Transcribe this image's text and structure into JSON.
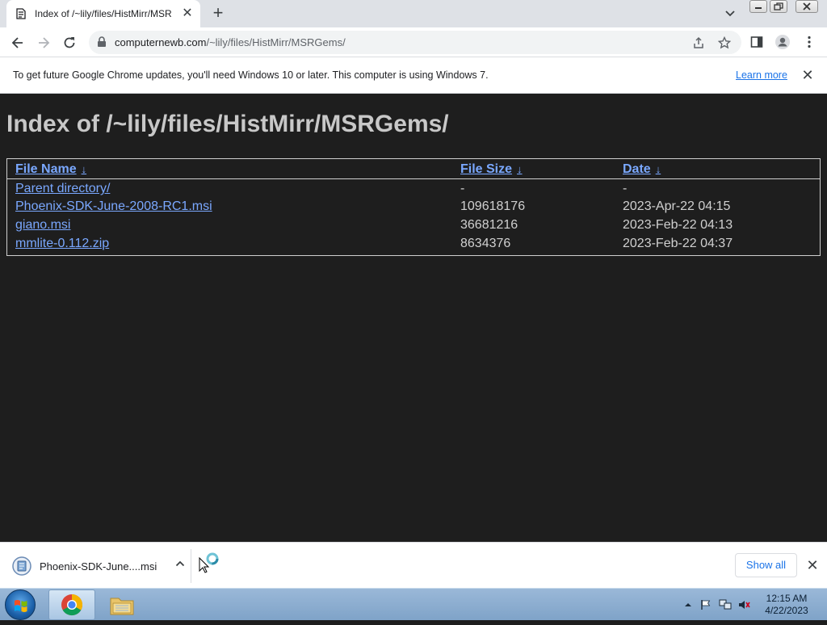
{
  "tab": {
    "title": "Index of /~lily/files/HistMirr/MSR",
    "close": "✕",
    "new_tab": "+"
  },
  "toolbar": {
    "url_host": "computernewb.com",
    "url_path": "/~lily/files/HistMirr/MSRGems/"
  },
  "infobar": {
    "message": "To get future Google Chrome updates, you'll need Windows 10 or later. This computer is using Windows 7.",
    "link": "Learn more",
    "close": "✕"
  },
  "page": {
    "heading": "Index of /~lily/files/HistMirr/MSRGems/",
    "columns": {
      "name": "File Name",
      "size": "File Size",
      "date": "Date",
      "sort_arrow": "↓"
    },
    "rows": [
      {
        "name": "Parent directory/",
        "size": "-",
        "date": "-"
      },
      {
        "name": "Phoenix-SDK-June-2008-RC1.msi",
        "size": "109618176",
        "date": "2023-Apr-22 04:15"
      },
      {
        "name": "giano.msi",
        "size": "36681216",
        "date": "2023-Feb-22 04:13"
      },
      {
        "name": "mmlite-0.112.zip",
        "size": "8634376",
        "date": "2023-Feb-22 04:37"
      }
    ]
  },
  "downloads": {
    "item_name": "Phoenix-SDK-June....msi",
    "chevron": "^",
    "show_all": "Show all",
    "close": "✕"
  },
  "taskbar": {
    "time": "12:15 AM",
    "date": "4/22/2023"
  },
  "colors": {
    "page_bg": "#1e1e1e",
    "link": "#7aa8ff",
    "accent": "#1a73e8"
  }
}
